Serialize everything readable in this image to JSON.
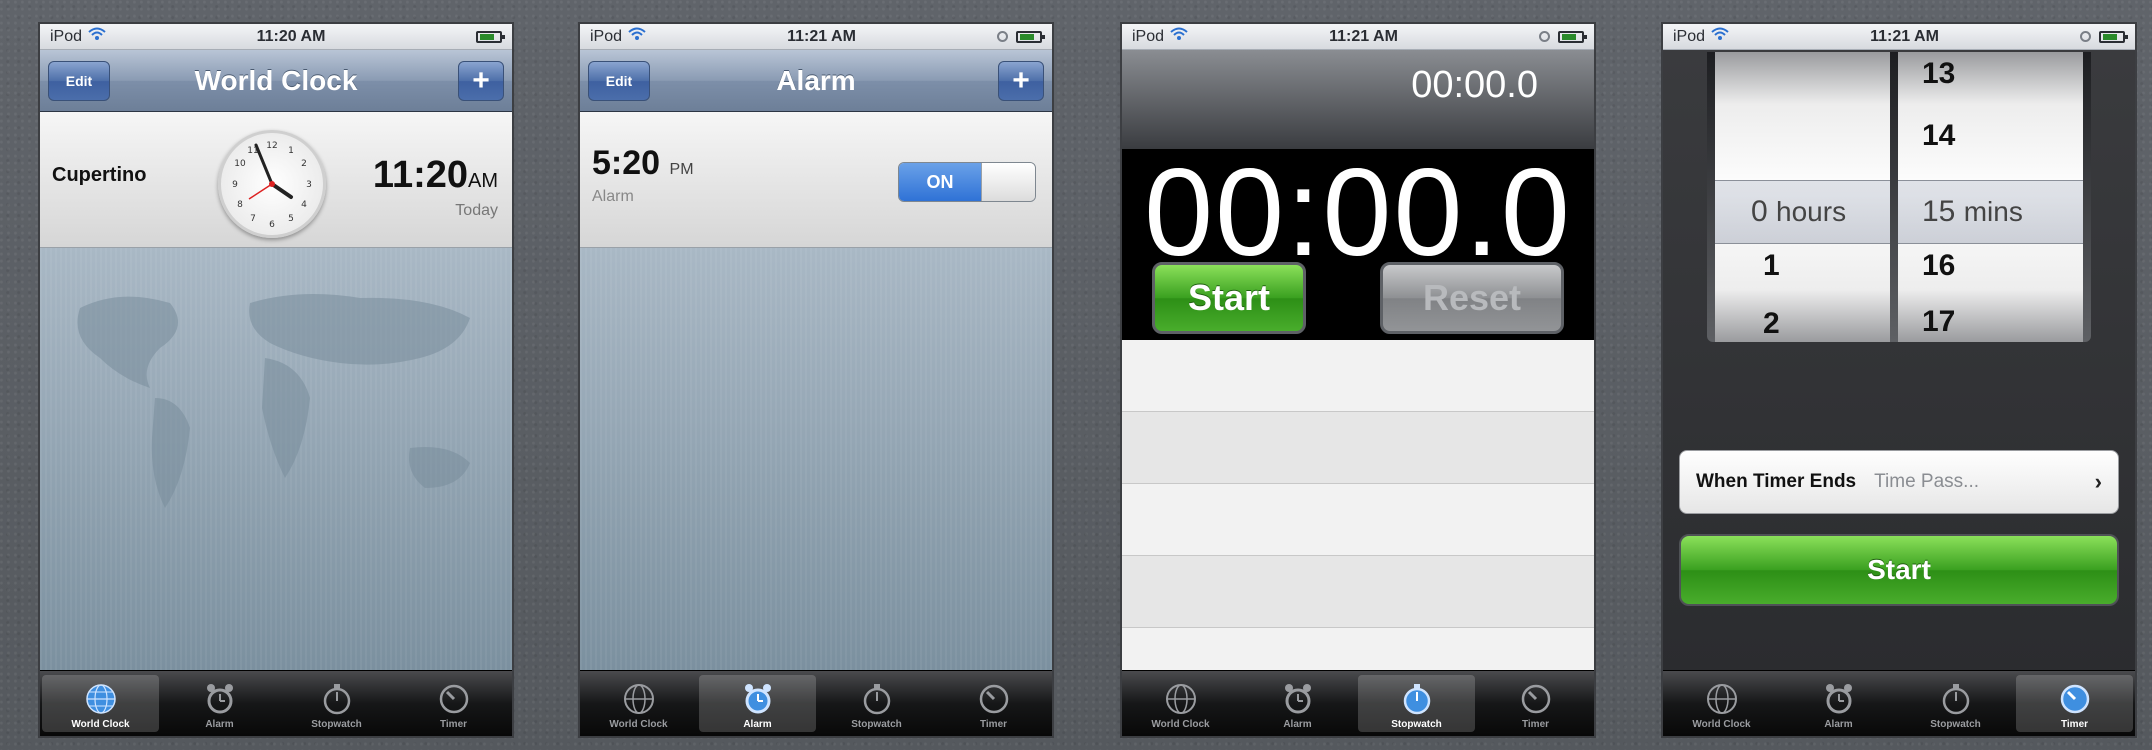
{
  "status_bar": {
    "carrier": "iPod",
    "times": [
      "11:20 AM",
      "11:21 AM",
      "11:21 AM",
      "11:21 AM"
    ]
  },
  "tabs": [
    "World Clock",
    "Alarm",
    "Stopwatch",
    "Timer"
  ],
  "world_clock": {
    "nav_title": "World Clock",
    "edit_label": "Edit",
    "add_label": "+",
    "city": "Cupertino",
    "time": "11:20",
    "ampm": "AM",
    "day": "Today"
  },
  "alarm": {
    "nav_title": "Alarm",
    "edit_label": "Edit",
    "add_label": "+",
    "time": "5:20",
    "ampm": "PM",
    "label": "Alarm",
    "toggle": "ON"
  },
  "stopwatch": {
    "lap_time": "00:00.0",
    "main_time": "00:00.0",
    "start_label": "Start",
    "reset_label": "Reset"
  },
  "timer": {
    "hours": [
      "",
      "",
      "0",
      "1",
      "2"
    ],
    "hours_unit": "hours",
    "mins": [
      "13",
      "14",
      "15",
      "16",
      "17"
    ],
    "mins_unit": "mins",
    "when_ends_label": "When Timer Ends",
    "when_ends_value": "Time Pass...",
    "start_label": "Start"
  },
  "colors": {
    "nav_blue": "#7d8fa9",
    "start_green": "#3aa020",
    "toggle_blue": "#2f72d6"
  }
}
